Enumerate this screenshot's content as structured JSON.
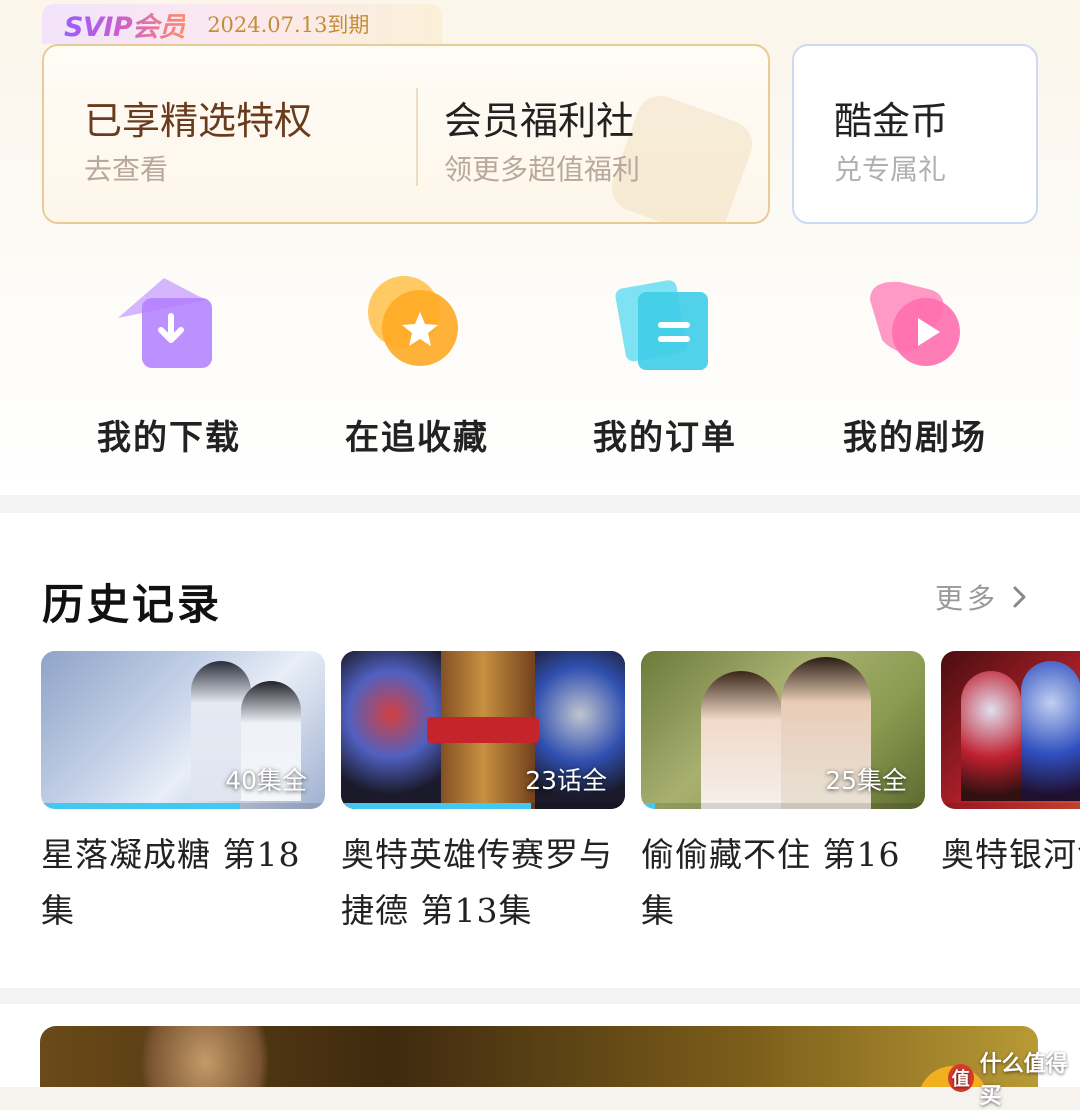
{
  "membership": {
    "badge": "SVIP会员",
    "expiry": "2024.07.13到期",
    "privilege": {
      "title": "已享精选特权",
      "subtitle": "去查看"
    },
    "welfare": {
      "title": "会员福利社",
      "subtitle": "领更多超值福利"
    },
    "coins": {
      "title": "酷金币",
      "subtitle": "兑专属礼"
    }
  },
  "quick_actions": [
    {
      "label": "我的下载",
      "icon": "download-icon",
      "color": "#b07cff"
    },
    {
      "label": "在追收藏",
      "icon": "star-icon",
      "color": "#ffb22e"
    },
    {
      "label": "我的订单",
      "icon": "order-icon",
      "color": "#3fcde8"
    },
    {
      "label": "我的剧场",
      "icon": "play-icon",
      "color": "#ff6fae"
    }
  ],
  "history": {
    "title": "历史记录",
    "more": "更多",
    "items": [
      {
        "badge": "40集全",
        "name": "星落凝成糖 第18集",
        "progress": 0.7
      },
      {
        "badge": "23话全",
        "name": "奥特英雄传赛罗与捷德 第13集",
        "progress": 0.67
      },
      {
        "badge": "25集全",
        "name": "偷偷藏不住 第16集",
        "progress": 0.05
      },
      {
        "badge": "",
        "name": "奥特银河命运的冲",
        "progress": 0
      }
    ]
  },
  "watermark": "什么值得买",
  "colors": {
    "accent": "#45c8ef",
    "gold_border": "#e8cc95",
    "brown_text": "#6b3b1d"
  }
}
